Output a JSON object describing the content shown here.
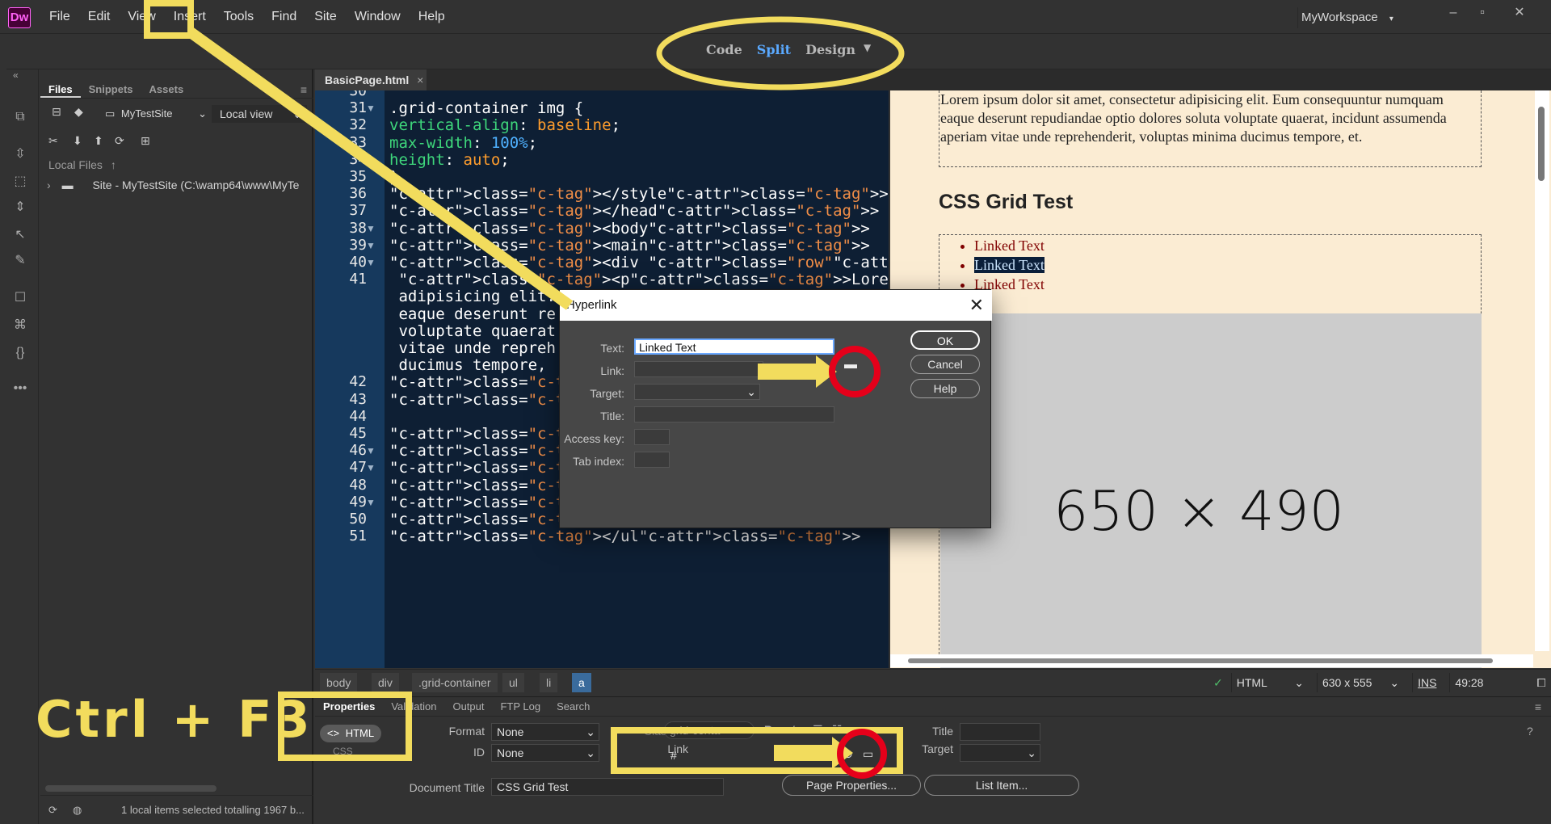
{
  "app": {
    "logo_text": "Dw",
    "menu": [
      "File",
      "Edit",
      "View",
      "Insert",
      "Tools",
      "Find",
      "Site",
      "Window",
      "Help"
    ],
    "workspace": "MyWorkspace"
  },
  "view_switch": {
    "code": "Code",
    "split": "Split",
    "design": "Design"
  },
  "files_panel": {
    "tabs": [
      "Files",
      "Snippets",
      "Assets"
    ],
    "site_name": "MyTestSite",
    "view_mode": "Local view",
    "local_files_label": "Local Files",
    "site_row": "Site - MyTestSite (C:\\wamp64\\www\\MyTe",
    "status": "1 local items selected totalling 1967 b..."
  },
  "document_tab": "BasicPage.html",
  "code_view": {
    "lines": [
      {
        "n": "30",
        "fold": false,
        "text": ""
      },
      {
        "n": "31",
        "fold": true,
        "text": ".grid-container img {"
      },
      {
        "n": "32",
        "fold": false,
        "text": "vertical-align: baseline;"
      },
      {
        "n": "33",
        "fold": false,
        "text": "max-width: 100%;"
      },
      {
        "n": "34",
        "fold": false,
        "text": "height: auto;"
      },
      {
        "n": "35",
        "fold": false,
        "text": "}"
      },
      {
        "n": "36",
        "fold": false,
        "text": "</style>"
      },
      {
        "n": "37",
        "fold": false,
        "text": "</head>"
      },
      {
        "n": "38",
        "fold": true,
        "text": "<body>"
      },
      {
        "n": "39",
        "fold": true,
        "text": "<main>"
      },
      {
        "n": "40",
        "fold": true,
        "text": "<div class=\"row\">"
      },
      {
        "n": "41",
        "fold": false,
        "text": " <p>Lorem ipsum do"
      },
      {
        "n": "",
        "fold": false,
        "text": " adipisicing elit."
      },
      {
        "n": "",
        "fold": false,
        "text": " eaque deserunt re"
      },
      {
        "n": "",
        "fold": false,
        "text": " voluptate quaerat"
      },
      {
        "n": "",
        "fold": false,
        "text": " vitae unde repreh"
      },
      {
        "n": "",
        "fold": false,
        "text": " ducimus tempore,"
      },
      {
        "n": "42",
        "fold": false,
        "text": "</div>"
      },
      {
        "n": "43",
        "fold": false,
        "text": "</main>"
      },
      {
        "n": "44",
        "fold": false,
        "text": ""
      },
      {
        "n": "45",
        "fold": false,
        "text": "<h2>CSS Grid Test</h2>"
      },
      {
        "n": "46",
        "fold": true,
        "text": "<div class=\"grid-container\">"
      },
      {
        "n": "47",
        "fold": true,
        "text": "<ul>"
      },
      {
        "n": "48",
        "fold": false,
        "text": "<li><a href=\"#\">Linked Text</a></li>"
      },
      {
        "n": "49",
        "fold": true,
        "text": "<li><a href=\"#\">Linked Text</a></li>"
      },
      {
        "n": "50",
        "fold": false,
        "text": "<li><a href=\"#\">Linked Text</a></li>"
      },
      {
        "n": "51",
        "fold": false,
        "text": "</ul>"
      }
    ]
  },
  "design_view": {
    "paragraph": "Lorem ipsum dolor sit amet, consectetur adipisicing elit. Eum consequuntur numquam eaque deserunt repudiandae optio dolores soluta voluptate quaerat, incidunt assumenda aperiam vitae unde reprehenderit, voluptas minima ducimus tempore, et.",
    "heading": "CSS Grid Test",
    "links": [
      "Linked Text",
      "Linked Text",
      "Linked Text"
    ],
    "placeholder": "650 × 490"
  },
  "tag_selector": {
    "crumbs": [
      "body",
      "div",
      ".grid-container",
      "ul",
      "li",
      "a"
    ],
    "doc_type": "HTML",
    "window_size": "630 x 555",
    "ins": "INS",
    "position": "49:28"
  },
  "properties": {
    "tabs": [
      "Properties",
      "Validation",
      "Output",
      "FTP Log",
      "Search"
    ],
    "html_btn": "HTML",
    "css_btn": "CSS",
    "format_label": "Format",
    "format_value": "None",
    "id_label": "ID",
    "id_value": "None",
    "class_label": "Class",
    "class_value": "grid-conta",
    "link_label": "Link",
    "link_value": "#",
    "title_label": "Title",
    "target_label": "Target",
    "doc_title_label": "Document Title",
    "doc_title_value": "CSS Grid Test",
    "page_properties": "Page Properties...",
    "list_item": "List Item..."
  },
  "hyperlink_dialog": {
    "title": "Hyperlink",
    "text_label": "Text:",
    "text_value": "Linked Text",
    "link_label": "Link:",
    "target_label": "Target:",
    "title_label": "Title:",
    "access_key_label": "Access key:",
    "tab_index_label": "Tab index:",
    "ok": "OK",
    "cancel": "Cancel",
    "help": "Help"
  },
  "annotations": {
    "shortcut": "Ctrl + F3",
    "color": "#f2dc5d",
    "circle_color": "#e5001a"
  }
}
